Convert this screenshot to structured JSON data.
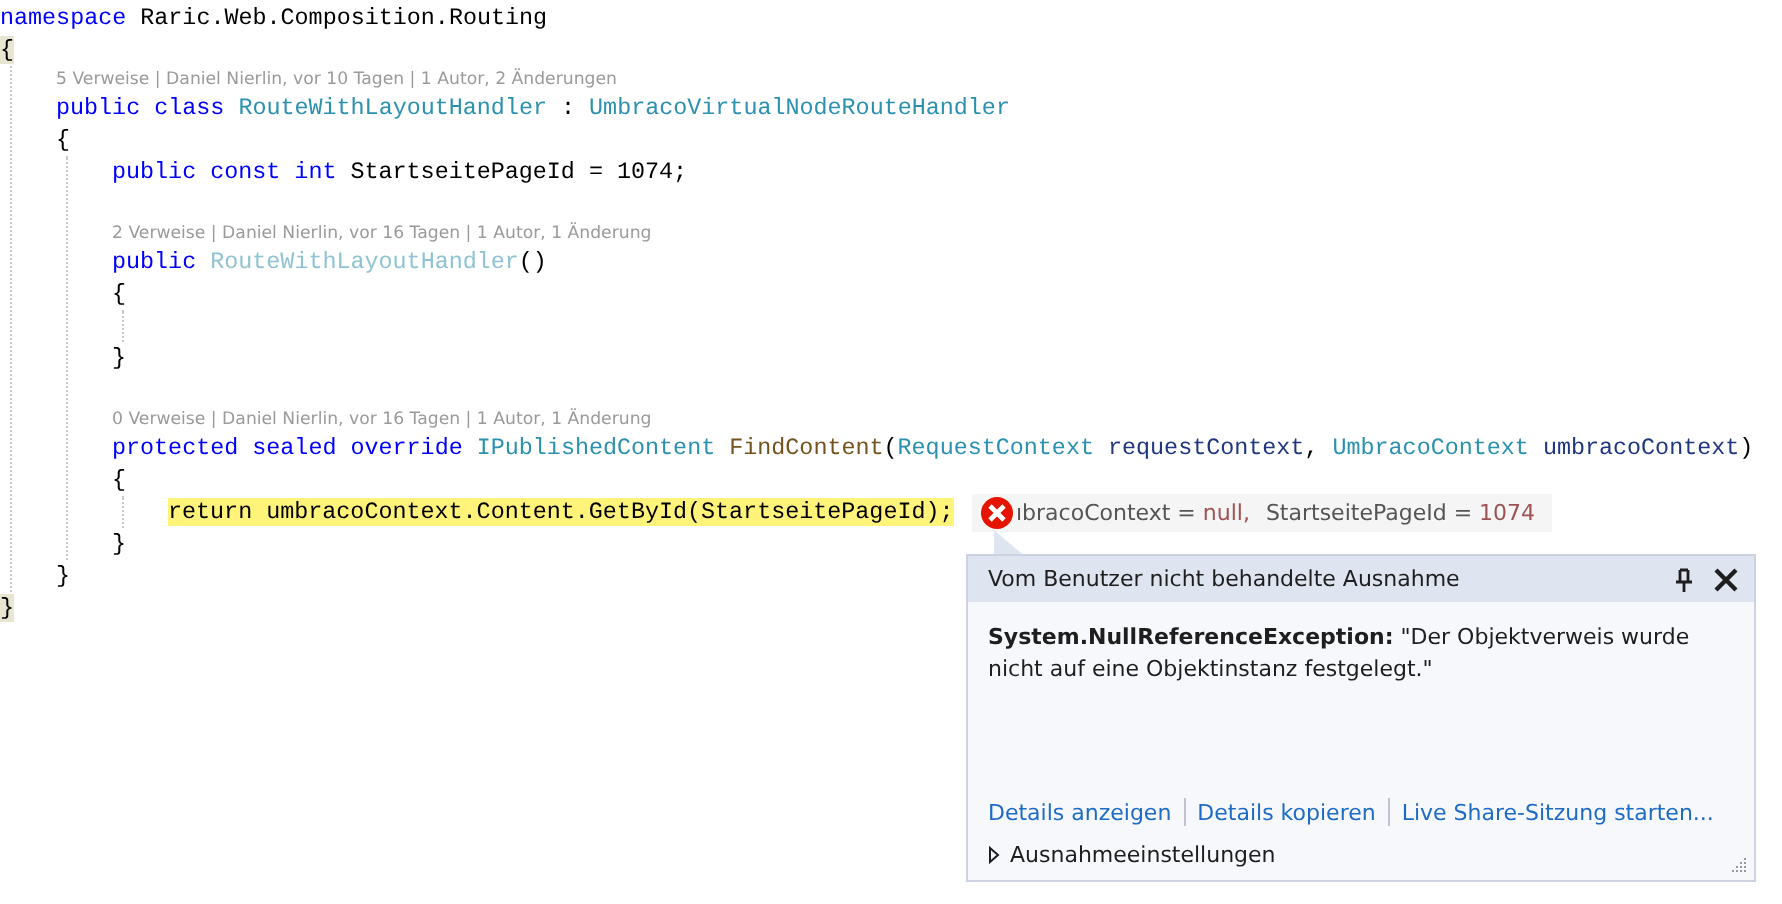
{
  "code_lines": [
    {
      "kind": "code",
      "tokens": [
        {
          "kind": "keyword",
          "text": "namespace"
        },
        {
          "kind": "plain",
          "text": " Raric.Web.Composition.Routing"
        }
      ]
    },
    {
      "kind": "code",
      "tokens": [
        {
          "kind": "brace-match",
          "text": "{"
        }
      ],
      "children": [
        {
          "kind": "lens",
          "text": "5 Verweise | Daniel Nierlin, vor 10 Tagen | 1 Autor, 2 Änderungen"
        },
        {
          "kind": "code",
          "tokens": [
            {
              "kind": "keyword",
              "text": "public class "
            },
            {
              "kind": "type",
              "text": "RouteWithLayoutHandler"
            },
            {
              "kind": "plain",
              "text": " : "
            },
            {
              "kind": "type",
              "text": "UmbracoVirtualNodeRouteHandler"
            }
          ]
        },
        {
          "kind": "code",
          "tokens": [
            {
              "kind": "plain",
              "text": "{"
            }
          ],
          "children": [
            {
              "kind": "code",
              "tokens": [
                {
                  "kind": "keyword",
                  "text": "public const int"
                },
                {
                  "kind": "plain",
                  "text": " StartseitePageId = 1074;"
                }
              ]
            },
            {
              "kind": "blank"
            },
            {
              "kind": "lens",
              "text": "2 Verweise | Daniel Nierlin, vor 16 Tagen | 1 Autor, 1 Änderung"
            },
            {
              "kind": "code",
              "tokens": [
                {
                  "kind": "keyword",
                  "text": "public "
                },
                {
                  "kind": "faded",
                  "text": "RouteWithLayoutHandler"
                },
                {
                  "kind": "plain",
                  "text": "()"
                }
              ]
            },
            {
              "kind": "code",
              "tokens": [
                {
                  "kind": "plain",
                  "text": "{"
                }
              ],
              "children": [
                {
                  "kind": "blank"
                }
              ]
            },
            {
              "kind": "code",
              "tokens": [
                {
                  "kind": "plain",
                  "text": "}"
                }
              ]
            },
            {
              "kind": "blank"
            },
            {
              "kind": "lens",
              "text": "0 Verweise | Daniel Nierlin, vor 16 Tagen | 1 Autor, 1 Änderung"
            },
            {
              "kind": "code",
              "tokens": [
                {
                  "kind": "keyword",
                  "text": "protected sealed override "
                },
                {
                  "kind": "type",
                  "text": "IPublishedContent"
                },
                {
                  "kind": "method",
                  "text": " FindContent"
                },
                {
                  "kind": "plain",
                  "text": "("
                },
                {
                  "kind": "type",
                  "text": "RequestContext"
                },
                {
                  "kind": "param",
                  "text": " requestContext"
                },
                {
                  "kind": "plain",
                  "text": ", "
                },
                {
                  "kind": "type",
                  "text": "UmbracoContext"
                },
                {
                  "kind": "param",
                  "text": " umbracoContext"
                },
                {
                  "kind": "plain",
                  "text": ")"
                }
              ]
            },
            {
              "kind": "code",
              "tokens": [
                {
                  "kind": "plain",
                  "text": "{"
                }
              ],
              "children": [
                {
                  "kind": "code",
                  "highlighted": true,
                  "tokens": [
                    {
                      "kind": "plain",
                      "text": "return umbracoContext.Content.GetById(StartseitePageId);"
                    }
                  ]
                }
              ]
            },
            {
              "kind": "code",
              "tokens": [
                {
                  "kind": "plain",
                  "text": "}"
                }
              ]
            }
          ]
        },
        {
          "kind": "code",
          "tokens": [
            {
              "kind": "plain",
              "text": "}"
            }
          ]
        }
      ]
    },
    {
      "kind": "code",
      "tokens": [
        {
          "kind": "brace-match",
          "text": "}"
        }
      ]
    }
  ],
  "data_tip": {
    "items": [
      {
        "name": "ıbracoContext = ",
        "value": "null,"
      },
      {
        "name": "StartseitePageId = ",
        "value": "1074"
      }
    ]
  },
  "exception_popup": {
    "title": "Vom Benutzer nicht behandelte Ausnahme",
    "message": "**System.NullReferenceException:** \"Der Objektverweis wurde nicht auf eine Objektinstanz festgelegt.\"",
    "links": [
      "Details anzeigen",
      "Details kopieren",
      "Live Share-Sitzung starten..."
    ],
    "settings": {
      "label": "Ausnahmeeinstellungen",
      "expanded": false
    }
  }
}
